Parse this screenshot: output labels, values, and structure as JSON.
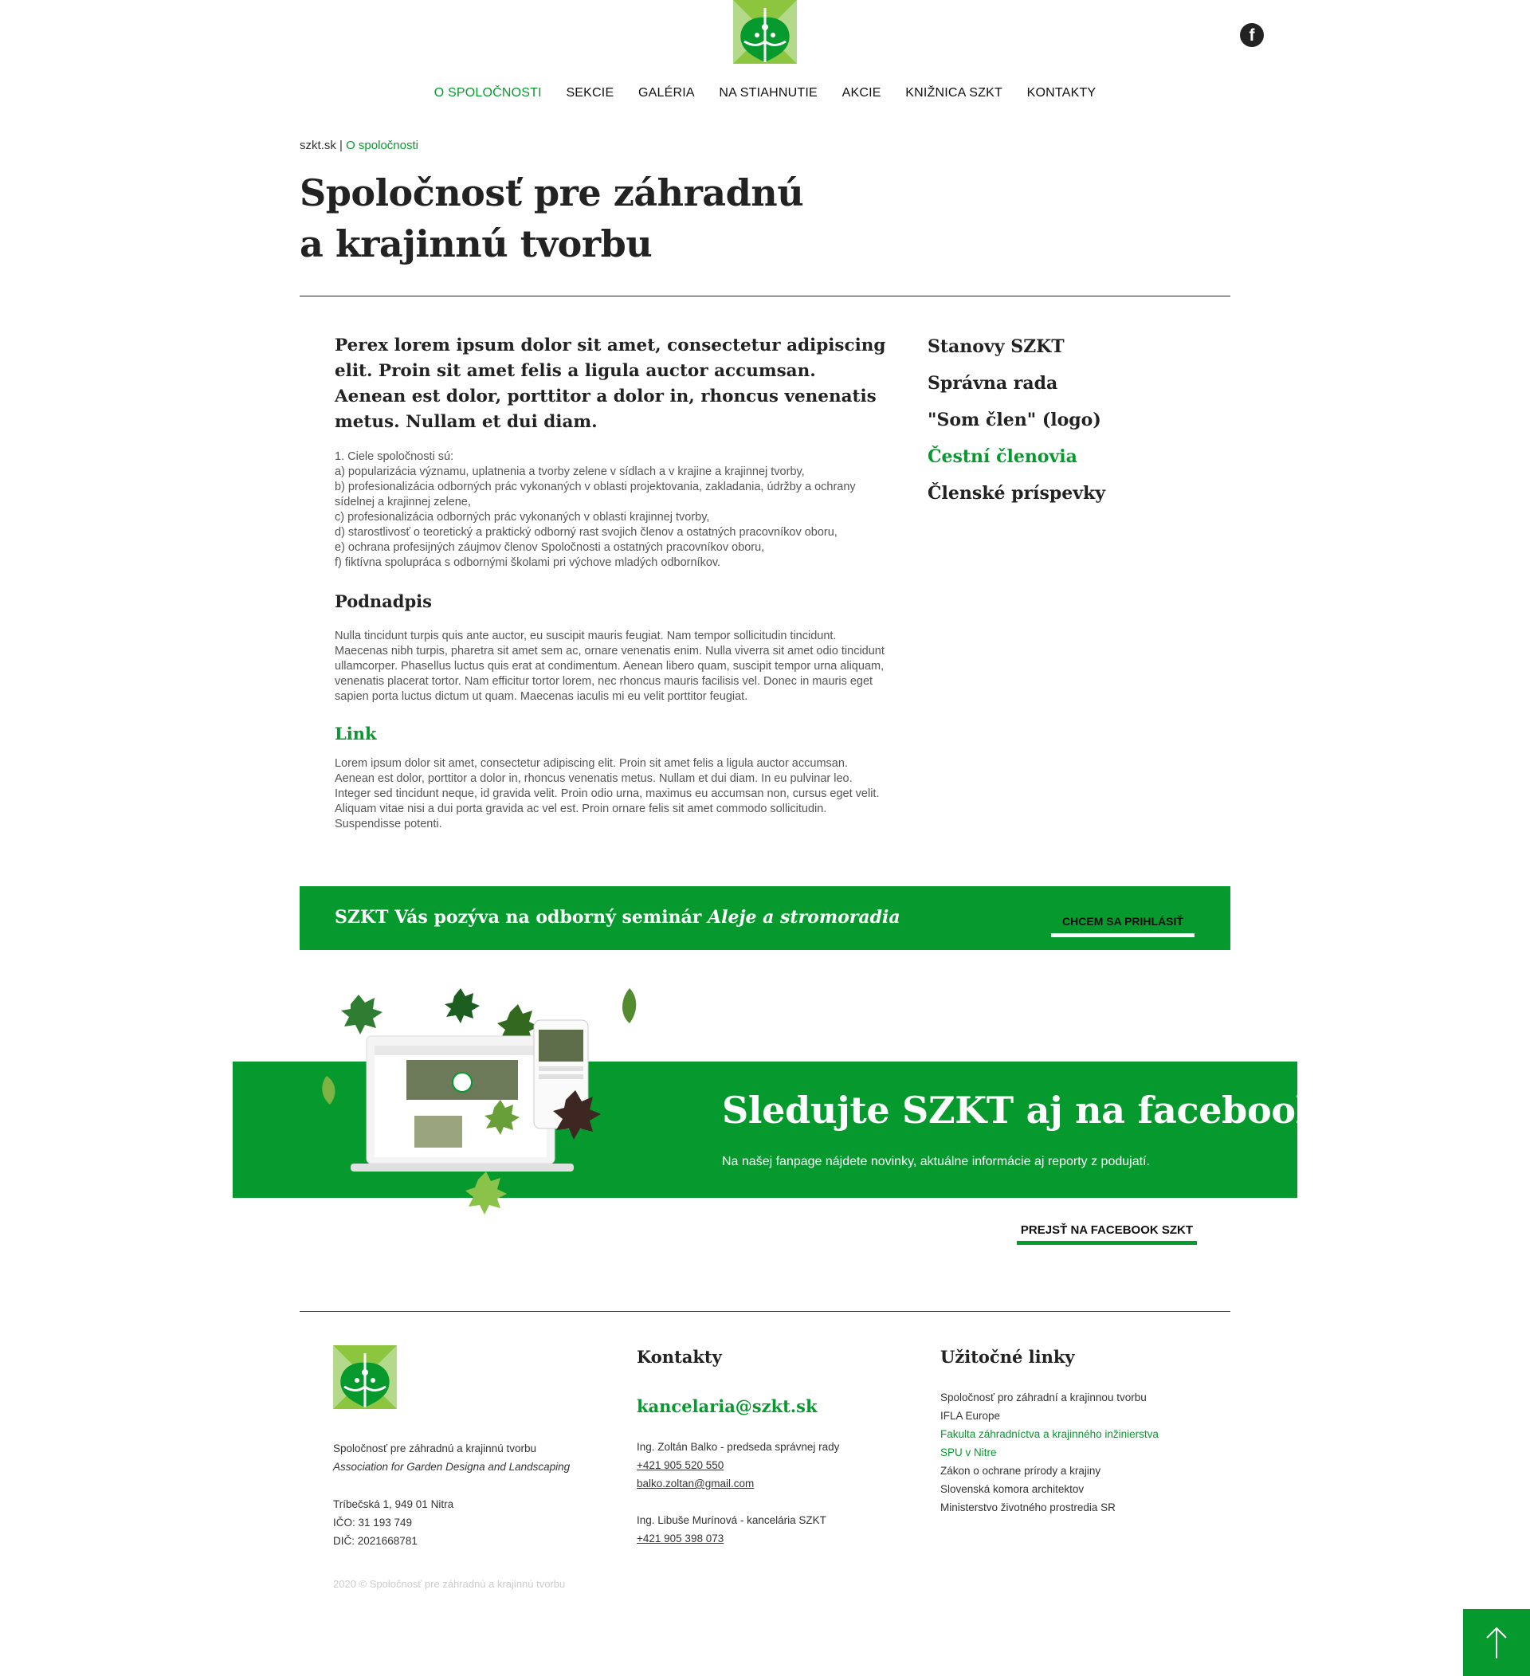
{
  "header": {
    "logo_alt": "SZKT",
    "facebook_icon": "f",
    "nav": [
      "O SPOLOČNOSTI",
      "SEKCIE",
      "GALÉRIA",
      "NA STIAHNUTIE",
      "AKCIE",
      "KNIŽNICA SZKT",
      "KONTAKTY"
    ]
  },
  "breadcrumb": {
    "home": "szkt.sk",
    "sep": "|",
    "current": "O spoločnosti"
  },
  "page": {
    "title_line1": "Spoločnosť pre záhradnú",
    "title_line2": "a krajinnú tvorbu"
  },
  "main": {
    "perex": "Perex lorem ipsum dolor sit amet, consectetur adipiscing elit. Proin sit amet felis a ligula auctor accumsan. Aenean est dolor, porttitor a dolor in, rhoncus venenatis metus. Nullam et dui diam.",
    "goals": [
      "1. Ciele spoločnosti sú:",
      "a) popularizácia významu, uplatnenia a tvorby zelene v sídlach a v krajine a krajinnej tvorby,",
      "b) profesionalizácia odborných prác vykonaných v oblasti projektovania, zakladania, údržby a ochrany sídelnej a krajinnej zelene,",
      "c) profesionalizácia odborných prác vykonaných v oblasti krajinnej tvorby,",
      "d) starostlivosť o teoretický a praktický odborný rast svojich členov a ostatných pracovníkov oboru,",
      "e) ochrana profesijných záujmov členov Spoločnosti a ostatných pracovníkov oboru,",
      "f) fiktívna spolupráca s odbornými školami pri výchove mladých odborníkov."
    ],
    "subtitle": "Podnadpis",
    "para": "Nulla tincidunt turpis quis ante auctor, eu suscipit mauris feugiat. Nam tempor sollicitudin tincidunt. Maecenas nibh turpis, pharetra sit amet sem ac, ornare venenatis enim. Nulla viverra sit amet odio tincidunt ullamcorper. Phasellus luctus quis erat at condimentum. Aenean libero quam, suscipit tempor urna aliquam, venenatis placerat tortor. Nam efficitur tortor lorem, nec rhoncus mauris facilisis vel. Donec in mauris eget sapien porta luctus dictum ut quam. Maecenas iaculis mi eu velit porttitor feugiat.",
    "link_title": "Link",
    "para2": "Lorem ipsum dolor sit amet, consectetur adipiscing elit. Proin sit amet felis a ligula auctor accumsan. Aenean est dolor, porttitor a dolor in, rhoncus venenatis metus. Nullam et dui diam. In eu pulvinar leo. Integer sed tincidunt neque, id gravida velit. Proin odio urna, maximus eu accumsan non, cursus eget velit. Aliquam vitae nisi a dui porta gravida ac vel est. Proin ornare felis sit amet commodo sollicitudin. Suspendisse potenti."
  },
  "side_menu": [
    "Stanovy SZKT",
    "Správna rada",
    "\"Som člen\" (logo)",
    "Čestní členovia",
    "Členské príspevky"
  ],
  "seminar": {
    "text": "SZKT Vás pozýva na odborný seminár ",
    "text_italic": "Aleje a stromoradia",
    "button": "CHCEM SA PRIHLÁSIŤ"
  },
  "facebook": {
    "title": "Sledujte SZKT aj na facebooku",
    "subtitle": "Na našej fanpage nájdete novinky, aktuálne informácie aj reporty z podujatí.",
    "button": "PREJSŤ NA FACEBOOK SZKT"
  },
  "footer": {
    "org_sk": "Spoločnosť pre záhradnú a krajinnú tvorbu",
    "org_en": "Association for Garden Designa and Landscaping",
    "address": "Tríbečská 1,  949 01 Nitra",
    "ico": "IČO: 31 193 749",
    "dic": "DIČ: 2021668781",
    "copyright": "2020 © Spoločnosť pre záhradnú a krajinnú tvorbu",
    "contacts_heading": "Kontakty",
    "email": "kancelaria@szkt.sk",
    "person1": "Ing. Zoltán Balko - predseda správnej rady",
    "phone1": "+421 905 520 550",
    "email1": "balko.zoltan@gmail.com",
    "person2": "Ing. Libuše Murínová - kancelária SZKT",
    "phone2": "+421 905 398 073",
    "links_heading": "Užitočné linky",
    "links": [
      "Spoločnosť pro záhradní a krajinnou tvorbu",
      "IFLA Europe",
      "Fakulta záhradníctva a krajinného inžinierstva",
      "SPU v Nitre",
      "Zákon o ochrane prírody a krajiny",
      "Slovenská komora architektov",
      "Ministerstvo životného prostredia SR"
    ]
  },
  "colors": {
    "brand_green": "#069a2e",
    "light_green": "#8cc63f",
    "text": "#222222"
  }
}
